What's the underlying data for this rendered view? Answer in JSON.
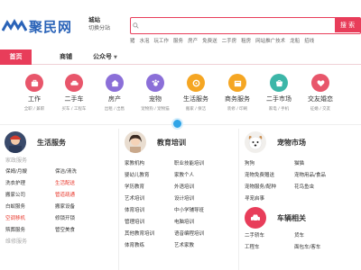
{
  "header": {
    "logo_text": "聚民网",
    "city_name": "城站",
    "city_switch": "切换分站",
    "search_button": "搜 索",
    "hotwords": [
      "猪",
      "水泡",
      "玩工作",
      "服务",
      "房产",
      "免费送",
      "二手房",
      "租房",
      "网站推广技术",
      "龙船",
      "招线"
    ]
  },
  "nav": {
    "home": "首页",
    "items": [
      "商铺",
      "公众号"
    ]
  },
  "categories": [
    {
      "label": "工作",
      "sub": "全职 / 兼职",
      "color": "#e8566b",
      "icon": "briefcase-icon"
    },
    {
      "label": "二手车",
      "sub": "买车 / 工程车",
      "color": "#e8566b",
      "icon": "car-icon"
    },
    {
      "label": "房产",
      "sub": "出租 / 出售",
      "color": "#8b6fd8",
      "icon": "house-icon"
    },
    {
      "label": "宠物",
      "sub": "宠物狗 / 宠物猫",
      "color": "#8b6fd8",
      "icon": "pet-icon"
    },
    {
      "label": "生活服务",
      "sub": "搬家 / 保洁",
      "color": "#f5a623",
      "icon": "service-icon"
    },
    {
      "label": "商务服务",
      "sub": "装修 / 印刷",
      "color": "#f5a623",
      "icon": "business-icon"
    },
    {
      "label": "二手市场",
      "sub": "家电 / 手机",
      "color": "#3cb6a8",
      "icon": "market-icon"
    },
    {
      "label": "交友婚恋",
      "sub": "征婚 / 交友",
      "color": "#e8566b",
      "icon": "heart-icon"
    }
  ],
  "columns": {
    "life": {
      "title": "生活服务",
      "section1": "家政服务",
      "rows": [
        [
          "保姆/月嫂",
          "保洁/清洗"
        ],
        [
          "洗衣护理",
          "生活配送"
        ],
        [
          "搬家公司",
          "管道疏通"
        ],
        [
          "白蚁服务",
          "搬家设备"
        ],
        [
          "空调移机",
          "修锁开锁"
        ],
        [
          "殡葬服务",
          "管空美食"
        ]
      ],
      "red_cells": [
        "生活配送",
        "管道疏通",
        "空调移机"
      ],
      "section2": "维修服务"
    },
    "edu": {
      "title": "教育培训",
      "rows": [
        [
          "家教机构",
          "职业技能培训"
        ],
        [
          "婴幼儿教育",
          "家教个人"
        ],
        [
          "学历教育",
          "外语培训"
        ],
        [
          "艺术培训",
          "设计培训"
        ],
        [
          "体育培训",
          "中小学辅导班"
        ],
        [
          "管理培训",
          "电脑培训"
        ],
        [
          "其他教育培训",
          "语音编程培训"
        ],
        [
          "体育教练",
          "艺术家教"
        ]
      ]
    },
    "pet": {
      "title": "宠物市场",
      "rows": [
        [
          "狗狗",
          "猫猫"
        ],
        [
          "宠物免费赠送",
          "宠物用品/食品"
        ],
        [
          "宠物服务/配种",
          "花鸟鱼虫"
        ],
        [
          "寻宠启事",
          ""
        ]
      ],
      "car_title": "车辆相关",
      "car_rows": [
        [
          "二手轿车",
          "货车"
        ],
        [
          "工程车",
          "面包车/客车"
        ]
      ]
    }
  },
  "colors": {
    "accent": "#e83d5a",
    "logo": "#2a63b8",
    "badge_blue": "#2fa4e7"
  }
}
